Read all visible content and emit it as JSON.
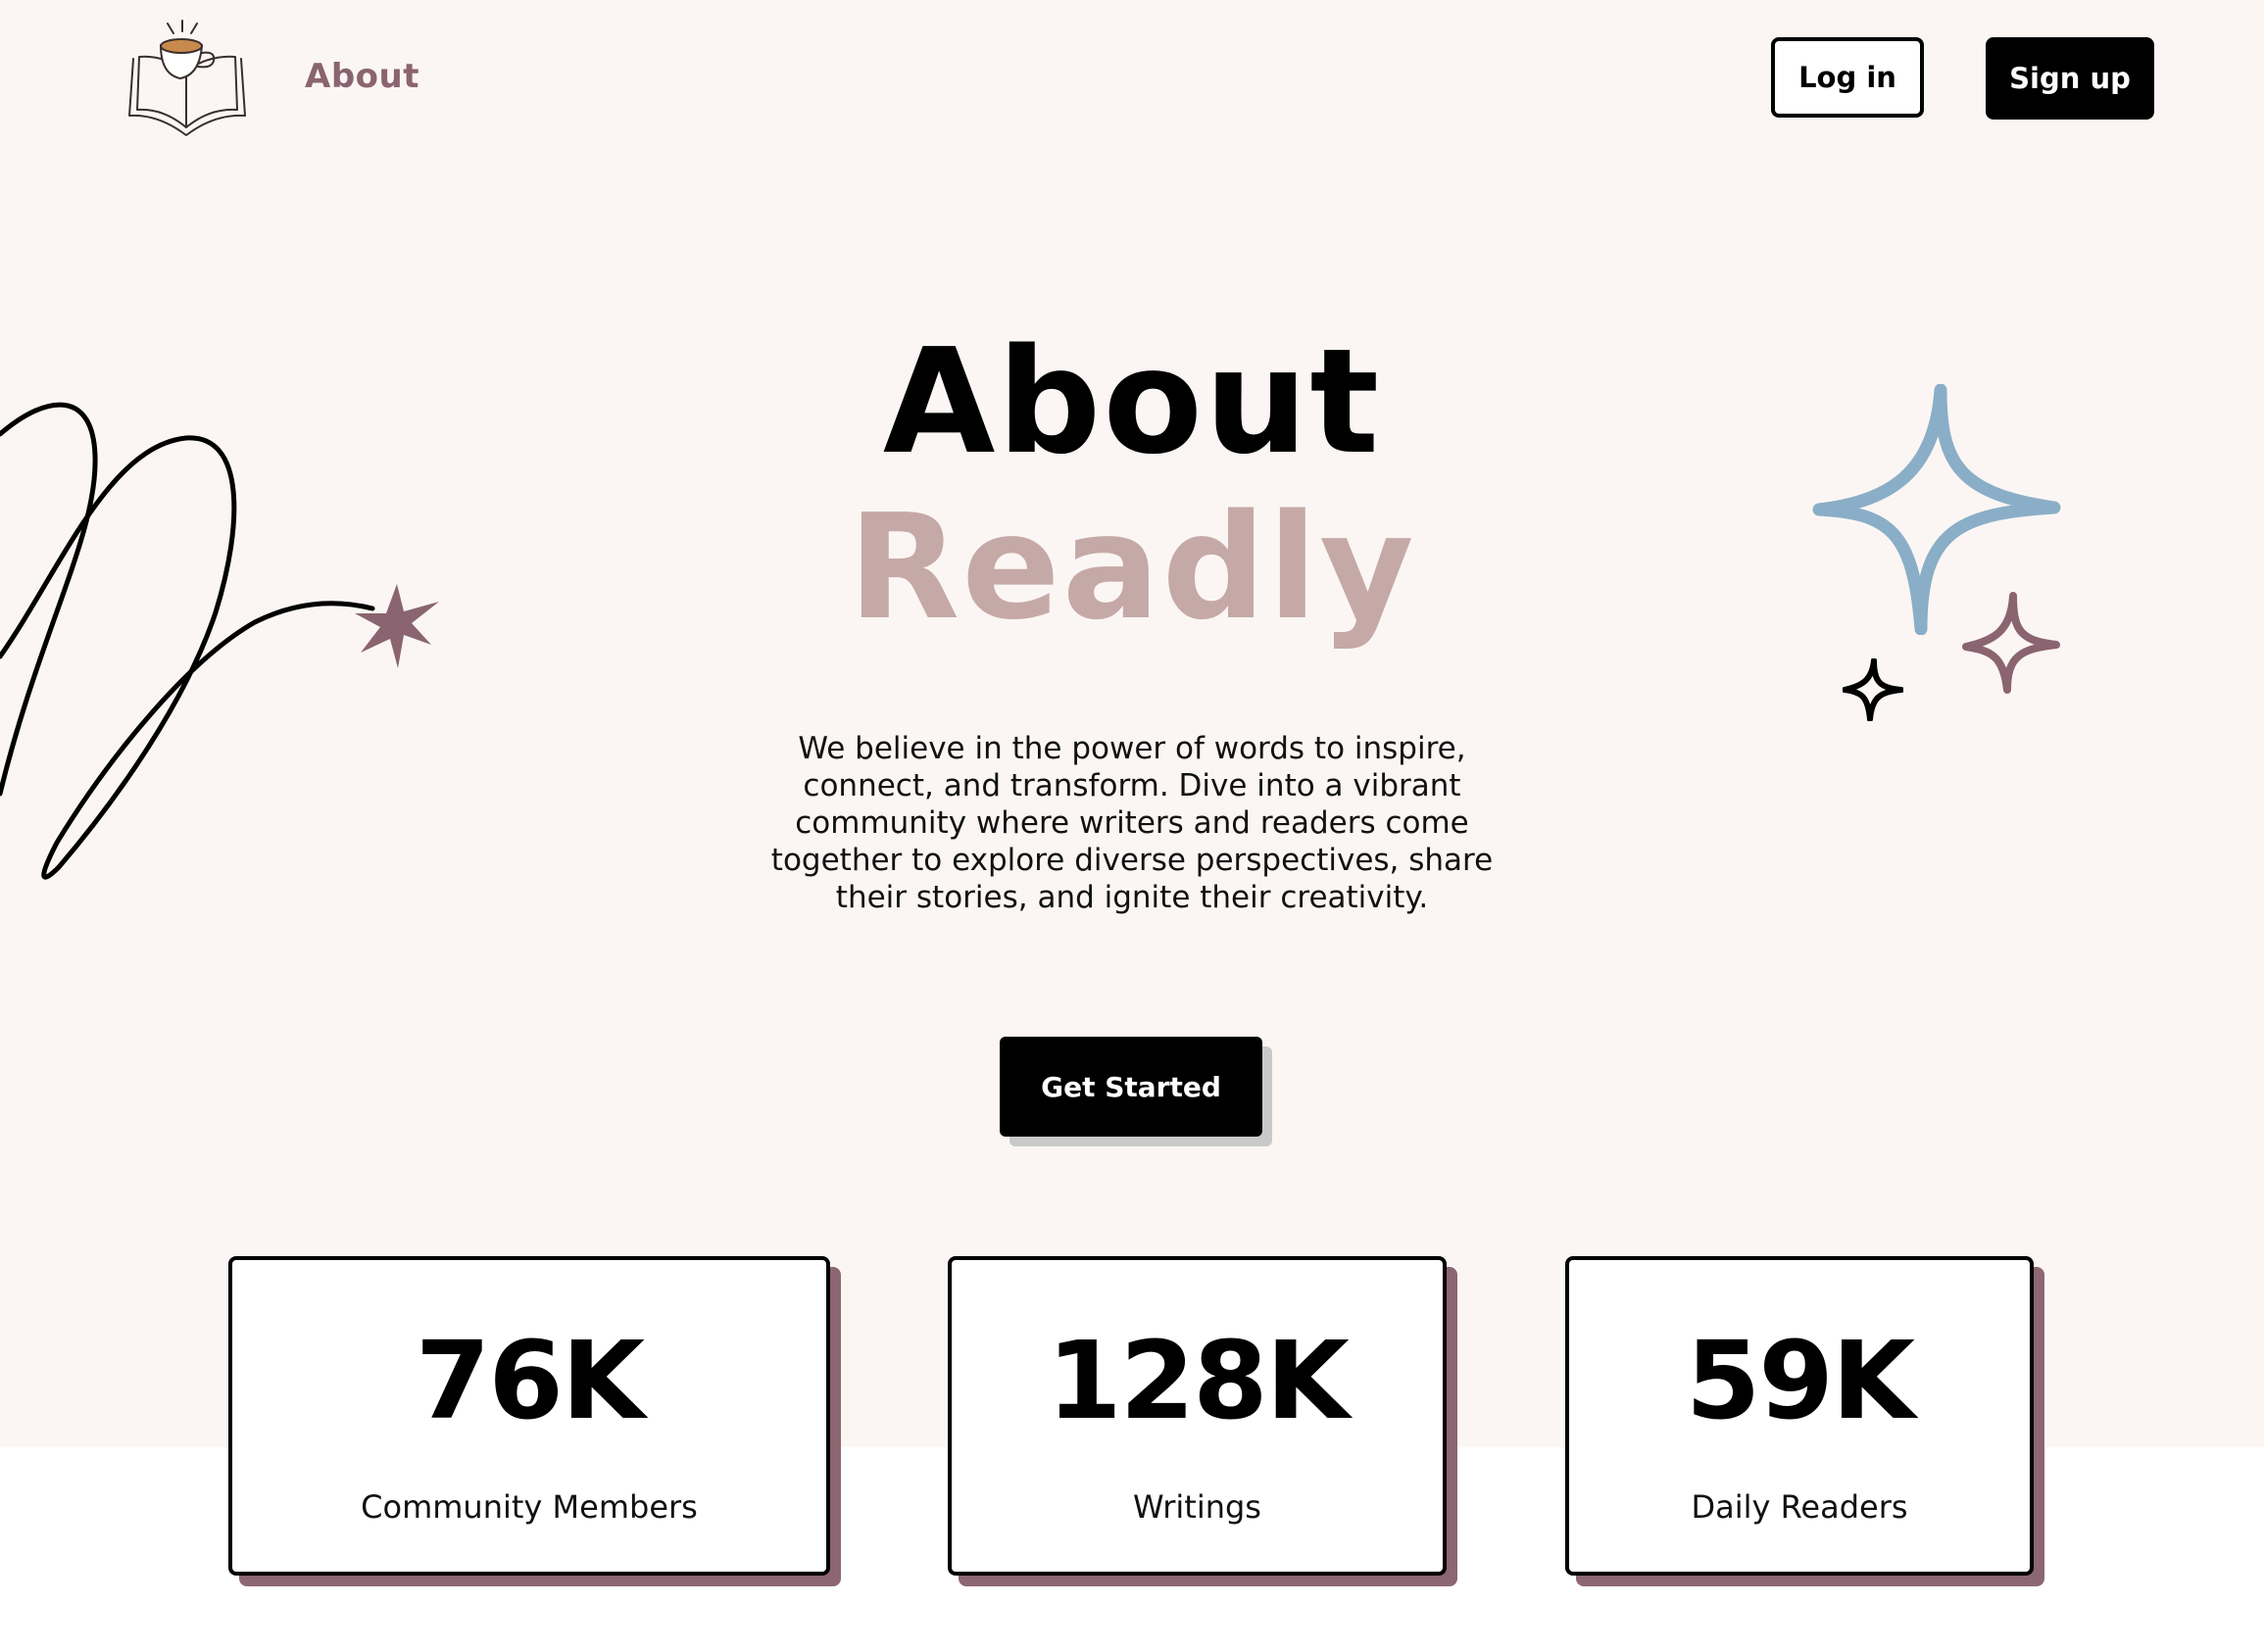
{
  "header": {
    "nav_about": "About",
    "login_label": "Log in",
    "signup_label": "Sign up",
    "logo_icon": "book-coffee-icon"
  },
  "hero": {
    "title": "About",
    "brand": "Readly",
    "description": "We believe in the power of words to inspire, connect, and transform. Dive into a vibrant community where writers and readers come together to explore diverse perspectives, share their stories, and ignite their creativity.",
    "cta_label": "Get Started"
  },
  "stats": [
    {
      "value": "76K",
      "label": "Community Members"
    },
    {
      "value": "128K",
      "label": "Writings"
    },
    {
      "value": "59K",
      "label": "Daily Readers"
    }
  ],
  "colors": {
    "background": "#fbf6f4",
    "accent_mauve": "#8a6470",
    "brand_pink": "#c5a9a6",
    "sparkle_blue": "#8aaec7",
    "card_shadow": "#8c6672"
  },
  "decorations": [
    "squiggle-line",
    "starburst-icon",
    "sparkle-icon-large",
    "sparkle-icon-medium",
    "sparkle-icon-small"
  ]
}
